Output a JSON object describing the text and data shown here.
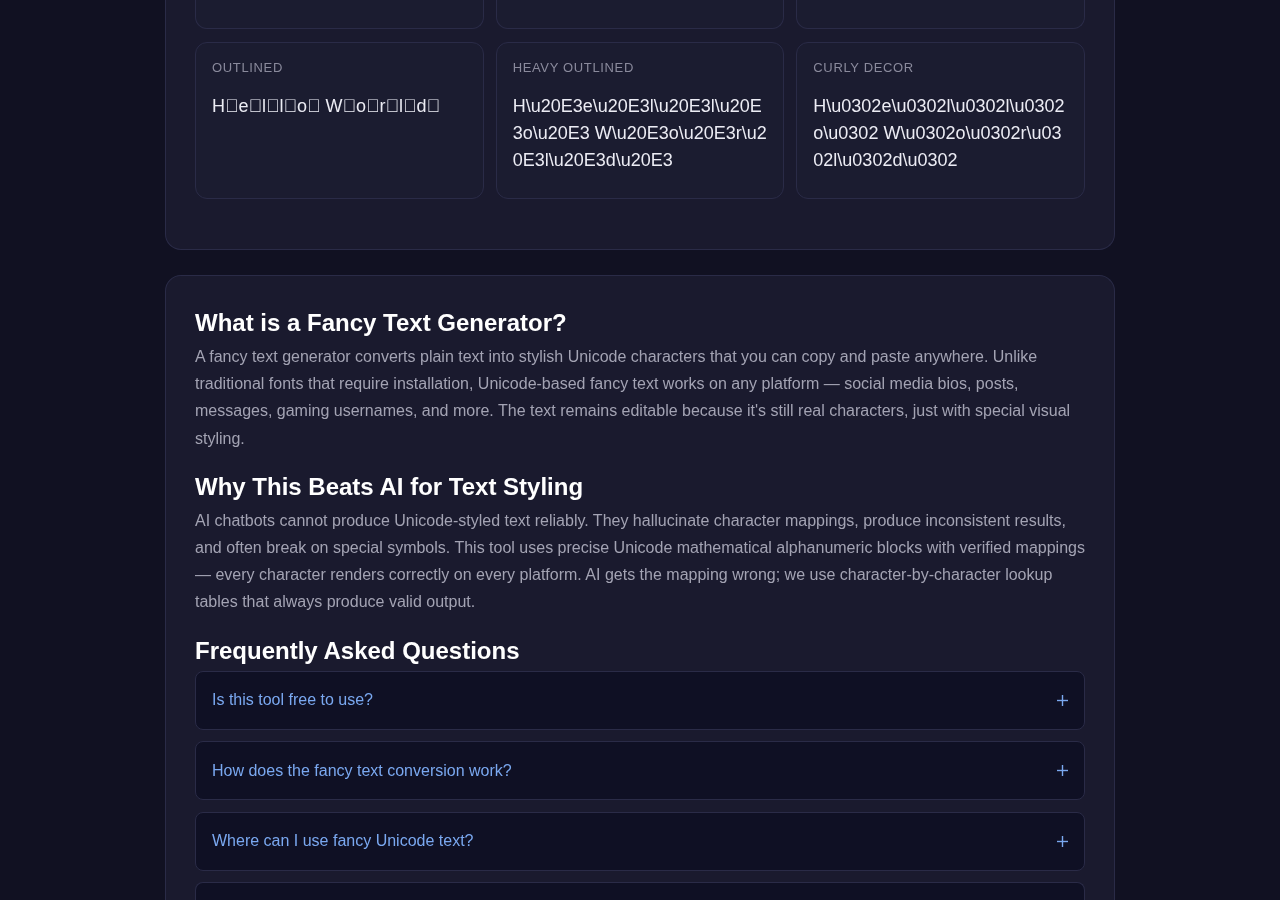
{
  "style_cards": [
    {
      "kind": "clipped"
    },
    {
      "kind": "clipped"
    },
    {
      "kind": "clipped"
    },
    {
      "kind": "sample",
      "label": "OUTLINED",
      "sample": "H⃝e⃝l⃝l⃝o⃝ W⃝o⃝r⃝l⃝d⃝"
    },
    {
      "kind": "sample",
      "label": "HEAVY OUTLINED",
      "sample": "H\\u20E3e\\u20E3l\\u20E3l\\u20E3o\\u20E3 W\\u20E3o\\u20E3r\\u20E3l\\u20E3d\\u20E3"
    },
    {
      "kind": "sample",
      "label": "CURLY DECOR",
      "sample": "H\\u0302e\\u0302l\\u0302l\\u0302o\\u0302 W\\u0302o\\u0302r\\u0302l\\u0302d\\u0302"
    }
  ],
  "sections": [
    {
      "heading": "What is a Fancy Text Generator?",
      "body": "A fancy text generator converts plain text into stylish Unicode characters that you can copy and paste anywhere. Unlike traditional fonts that require installation, Unicode-based fancy text works on any platform — social media bios, posts, messages, gaming usernames, and more. The text remains editable because it's still real characters, just with special visual styling."
    },
    {
      "heading": "Why This Beats AI for Text Styling",
      "body": "AI chatbots cannot produce Unicode-styled text reliably. They hallucinate character mappings, produce inconsistent results, and often break on special symbols. This tool uses precise Unicode mathematical alphanumeric blocks with verified mappings — every character renders correctly on every platform. AI gets the mapping wrong; we use character-by-character lookup tables that always produce valid output."
    }
  ],
  "faq": {
    "heading": "Frequently Asked Questions",
    "items": [
      {
        "kind": "question",
        "question": "Is this tool free to use?",
        "expanded": false
      },
      {
        "kind": "question",
        "question": "How does the fancy text conversion work?",
        "expanded": false
      },
      {
        "kind": "question",
        "question": "Where can I use fancy Unicode text?",
        "expanded": false
      },
      {
        "kind": "clipped"
      }
    ]
  }
}
